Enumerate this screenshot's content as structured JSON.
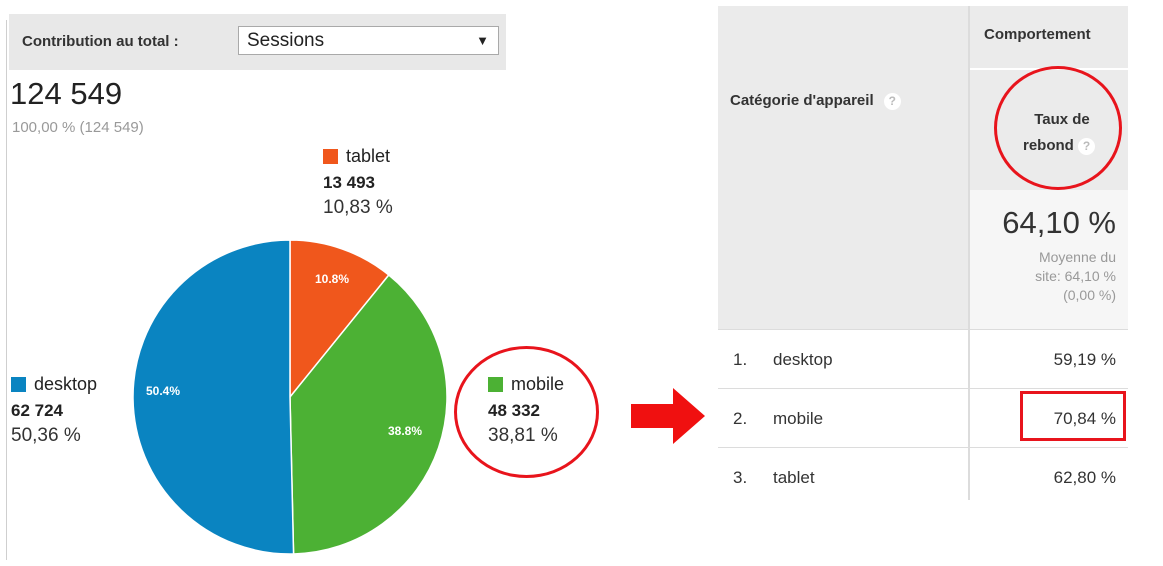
{
  "control": {
    "label": "Contribution au total :",
    "selected": "Sessions",
    "caret": "▼"
  },
  "total": {
    "value": "124 549",
    "sub": "100,00 % (124 549)"
  },
  "chart_data": {
    "type": "pie",
    "slices": [
      {
        "label": "desktop",
        "value": 62724,
        "value_text": "62 724",
        "pct_text": "50,36 %",
        "slice_label": "50.4%",
        "color": "#0a84c1"
      },
      {
        "label": "tablet",
        "value": 13493,
        "value_text": "13 493",
        "pct_text": "10,83 %",
        "slice_label": "10.8%",
        "color": "#f0571c"
      },
      {
        "label": "mobile",
        "value": 48332,
        "value_text": "48 332",
        "pct_text": "38,81 %",
        "slice_label": "38.8%",
        "color": "#4cb134"
      }
    ]
  },
  "table": {
    "group_header": "Comportement",
    "dimension_header": "Catégorie d'appareil",
    "metric_header_line1": "Taux de",
    "metric_header_line2": "rebond",
    "help": "?",
    "summary_value": "64,10 %",
    "summary_note_1": "Moyenne du",
    "summary_note_2": "site: 64,10 %",
    "summary_note_3": "(0,00 %)",
    "rows": [
      {
        "index": "1.",
        "name": "desktop",
        "rate": "59,19 %"
      },
      {
        "index": "2.",
        "name": "mobile",
        "rate": "70,84 %"
      },
      {
        "index": "3.",
        "name": "tablet",
        "rate": "62,80 %"
      }
    ]
  },
  "colors": {
    "highlight": "#e8141c",
    "arrow": "#f01010"
  }
}
